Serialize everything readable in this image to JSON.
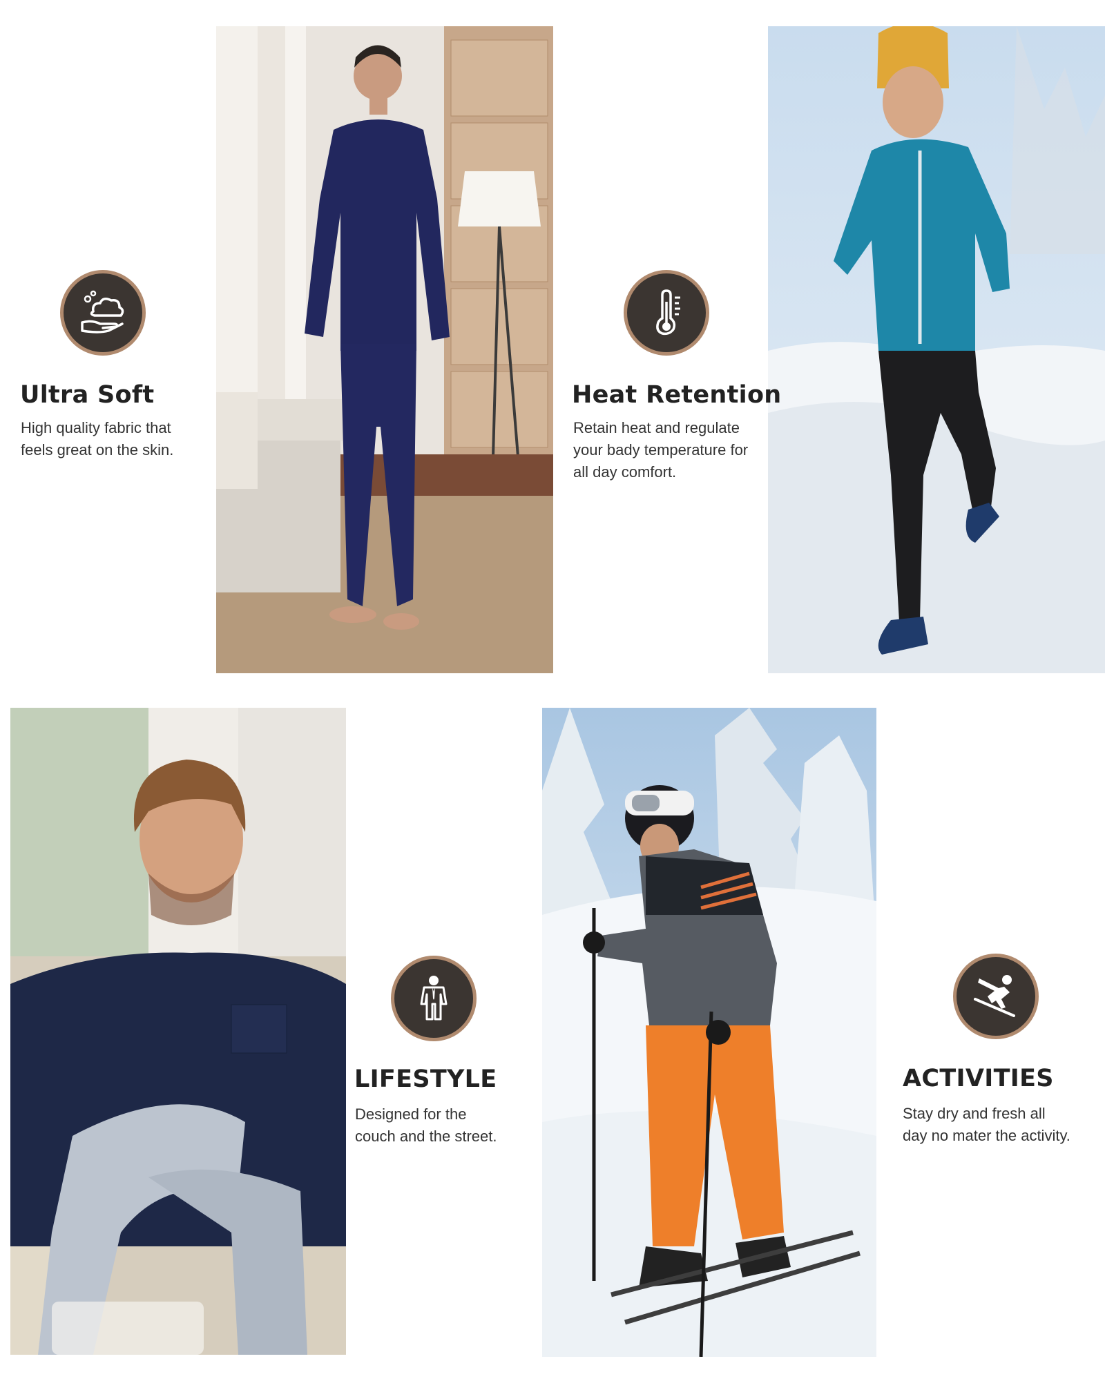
{
  "features": [
    {
      "title": "Ultra Soft",
      "desc_lines": [
        "High quality fabric that",
        "feels great on the skin."
      ],
      "icon": "cloud-hand-icon"
    },
    {
      "title": "Heat Retention",
      "desc_lines": [
        "Retain heat and regulate",
        "your bady temperature for",
        "all day comfort."
      ],
      "icon": "thermometer-icon"
    },
    {
      "title": "LIFESTYLE",
      "desc_lines": [
        "Designed for the",
        "couch and the street."
      ],
      "icon": "person-suit-icon"
    },
    {
      "title": "ACTIVITIES",
      "desc_lines": [
        "Stay dry and fresh all",
        "day no mater the activity."
      ],
      "icon": "skier-icon"
    }
  ],
  "colors": {
    "badge_fill": "#3b3531",
    "badge_ring": "#b08a6e",
    "title_text": "#222222",
    "body_text": "#333333"
  }
}
